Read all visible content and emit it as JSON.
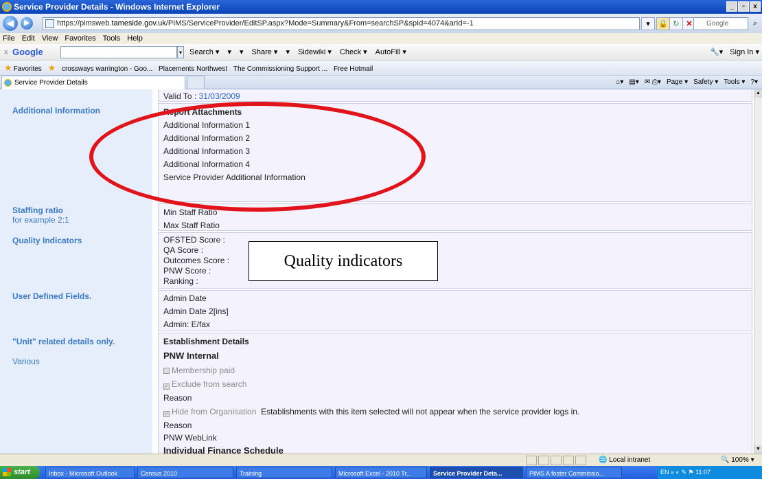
{
  "window": {
    "title": "Service Provider Details - Windows Internet Explorer",
    "buttons": [
      "_",
      "▫",
      "x"
    ]
  },
  "address": {
    "url_prefix": "https://pimsweb.",
    "url_domain": "tameside.gov.uk",
    "url_rest": "/PIMS/ServiceProvider/EditSP.aspx?Mode=Summary&From=searchSP&spId=4074&arId=-1",
    "search_placeholder": "Google"
  },
  "menu": [
    "File",
    "Edit",
    "View",
    "Favorites",
    "Tools",
    "Help"
  ],
  "google_toolbar": {
    "logo": "Google",
    "items": [
      "Search ▾",
      "▾",
      "▾",
      "Share ▾",
      "▾",
      "Sidewiki ▾",
      "Check ▾",
      "AutoFill ▾"
    ],
    "sign_in": "Sign In ▾"
  },
  "favorites": {
    "label": "Favorites",
    "items": [
      "crossways warrington - Goo...",
      "Placements Northwest",
      "The Commissioning Support ...",
      "Free Hotmail"
    ]
  },
  "tab": {
    "title": "Service Provider Details",
    "commands": [
      "▾",
      "▾",
      "▾",
      "Page ▾",
      "Safety ▾",
      "Tools ▾",
      "▾"
    ]
  },
  "content": {
    "valid_to_label": "Valid To :",
    "valid_to_value": "31/03/2009",
    "additional_info": {
      "label": "Additional Information",
      "heading": "Report Attachments",
      "items": [
        "Additional Information 1",
        "Additional Information 2",
        "Additional Information 3",
        "Additional Information 4",
        "Service Provider Additional Information"
      ]
    },
    "staffing": {
      "label": "Staffing ratio",
      "hint": "for example 2:1",
      "items": [
        "Min Staff Ratio",
        "Max Staff Ratio"
      ]
    },
    "quality": {
      "label": "Quality Indicators",
      "items": [
        "OFSTED Score :",
        "QA Score :",
        "Outcomes Score :",
        "PNW Score :",
        "Ranking :"
      ]
    },
    "user_defined": {
      "label": "User Defined Fields.",
      "items": [
        "Admin Date",
        "Admin Date 2[ins]",
        "Admin: E/fax"
      ]
    },
    "unit": {
      "label": "\"Unit\" related details only.",
      "hint": "Various",
      "heading1": "Establishment Details",
      "heading2": "PNW Internal",
      "membership": "Membership paid",
      "exclude": "Exclude from search",
      "reason1": "Reason",
      "hide": "Hide from Organisation",
      "hide_note": "Establishments with this item selected will not appear when the service provider logs in.",
      "reason2": "Reason",
      "weblink": "PNW WebLink",
      "finance": "Individual Finance Schedule"
    }
  },
  "annotation": {
    "box_text": "Quality indicators",
    "ellipse_color": "#e0141a"
  },
  "status": {
    "zone": "Local intranet",
    "zoom": "100%"
  },
  "taskbar": {
    "start": "start",
    "tasks": [
      "Inbox - Microsoft Outlook",
      "Census 2010",
      "Training",
      "Microsoft Excel - 2010 Tr...",
      "Service Provider Deta...",
      "PIMS A foster Commissio..."
    ],
    "lang": "EN",
    "time": "11:07"
  }
}
